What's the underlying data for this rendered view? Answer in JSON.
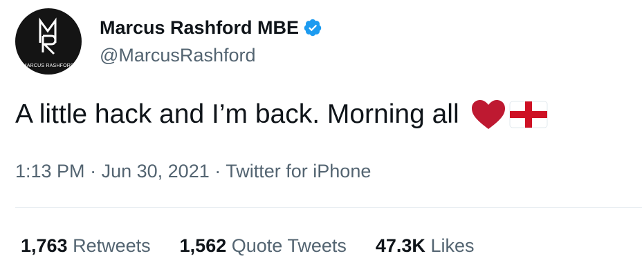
{
  "author": {
    "display_name": "Marcus Rashford MBE",
    "handle": "@MarcusRashford",
    "avatar_text": "MARCUS RASHFORD",
    "avatar_monogram": "MR",
    "verified": true
  },
  "tweet": {
    "text": "A little hack and I’m back. Morning all",
    "emoji": [
      "red-heart-icon",
      "england-flag-icon"
    ]
  },
  "meta": {
    "time": "1:13 PM",
    "date": "Jun 30, 2021",
    "source": "Twitter for iPhone",
    "separator": "·"
  },
  "stats": [
    {
      "count": "1,763",
      "label": "Retweets"
    },
    {
      "count": "1,562",
      "label": "Quote Tweets"
    },
    {
      "count": "47.3K",
      "label": "Likes"
    }
  ],
  "colors": {
    "verified_blue": "#1d9bf0",
    "heart_red": "#be1931",
    "flag_red": "#ce1124",
    "muted_text": "#536471"
  }
}
